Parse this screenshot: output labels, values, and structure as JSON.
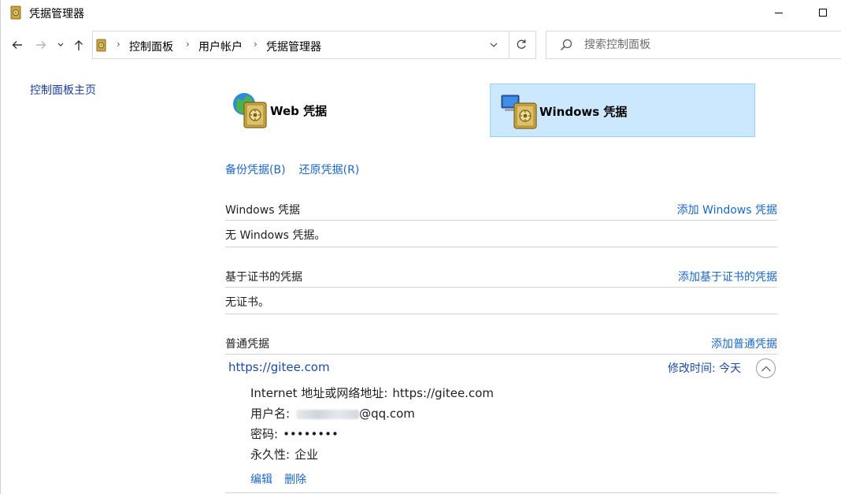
{
  "window": {
    "title": "凭据管理器",
    "icon": "credential-vault-icon"
  },
  "navigation": {
    "breadcrumbs": [
      "控制面板",
      "用户帐户",
      "凭据管理器"
    ],
    "search_placeholder": "搜索控制面板"
  },
  "sidebar": {
    "home_link": "控制面板主页"
  },
  "tiles": {
    "web_label": "Web 凭据",
    "windows_label": "Windows 凭据",
    "selected": "windows"
  },
  "actions": {
    "backup": "备份凭据(B)",
    "restore": "还原凭据(R)"
  },
  "sections": {
    "windows": {
      "title": "Windows 凭据",
      "add": "添加 Windows 凭据",
      "empty": "无 Windows 凭据。"
    },
    "certificate": {
      "title": "基于证书的凭据",
      "add": "添加基于证书的凭据",
      "empty": "无证书。"
    },
    "generic": {
      "title": "普通凭据",
      "add": "添加普通凭据",
      "credential": {
        "name": "https://gitee.com",
        "modified": "修改时间: 今天",
        "address_label": "Internet 地址或网络地址:",
        "address_value": "https://gitee.com",
        "username_label": "用户名:",
        "username_suffix": "@qq.com",
        "password_label": "密码:",
        "password_value": "••••••••",
        "persistence_label": "永久性:",
        "persistence_value": "企业",
        "edit": "编辑",
        "delete": "删除"
      }
    }
  },
  "colors": {
    "link": "#1c68c6",
    "selected_tile": "#cce8ff",
    "selected_tile_border": "#99d1ff"
  }
}
